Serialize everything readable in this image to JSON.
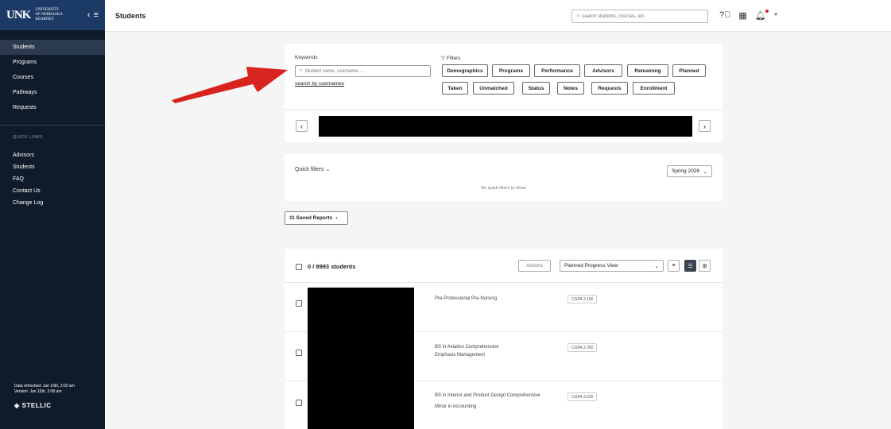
{
  "sidebar": {
    "logo": "UNK",
    "logo_sub": [
      "University",
      "of Nebraska",
      "Kearney"
    ],
    "collapse_icon": "chevron-left-icon",
    "menu_icon": "hamburger-icon",
    "nav": [
      "Students",
      "Programs",
      "Courses",
      "Pathways",
      "Requests"
    ],
    "quick_links_title": "QUICK LINKS",
    "quick_links": [
      "Advisors",
      "Students",
      "FAQ",
      "Contact Us",
      "Change Log"
    ],
    "footer_refreshed": "Data refreshed: Jan 16th, 2:02 am",
    "footer_version": "Version: Jan 15th, 3:08 am",
    "brand_footer": "STELLIC"
  },
  "header": {
    "title": "Students",
    "search_placeholder": "search students, courses, etc."
  },
  "search_card": {
    "keywords_label": "Keywords",
    "keyword_placeholder": "Student name, username...",
    "search_by_usernames": "search by usernames",
    "filters_label": "Filters",
    "filter_chips_row1": [
      "Demographics",
      "Programs",
      "Performance",
      "Advisors",
      "Remaining",
      "Planned"
    ],
    "filter_chips_row2": [
      "Taken",
      "Unmatched",
      "Status",
      "Notes",
      "Requests",
      "Enrollment"
    ]
  },
  "quick_filters": {
    "label": "Quick filters",
    "empty": "No quick filters to show",
    "term": "Spring 2026"
  },
  "saved_reports": "11 Saved Reports",
  "list": {
    "count": "0 / 8993 students",
    "actions": "Actions",
    "view": "Planned Progress View",
    "rows": [
      {
        "program_1": "Pre-Professional Pre-Nursing",
        "program_2": "",
        "cgpa": "CGPA 3.166"
      },
      {
        "program_1": "BS in Aviation Comprehensive",
        "program_2": "Emphasis Management",
        "cgpa": "CGPA 3.260"
      },
      {
        "program_1": "BS in Interior and Product Design Comprehensive",
        "program_2": "Minor in Accounting",
        "cgpa": "CGPA 3.520"
      }
    ]
  },
  "colors": {
    "sidebar_bg": "#0f1a2b",
    "brand_bg": "#1c3a66",
    "arrow": "#d9231f"
  }
}
